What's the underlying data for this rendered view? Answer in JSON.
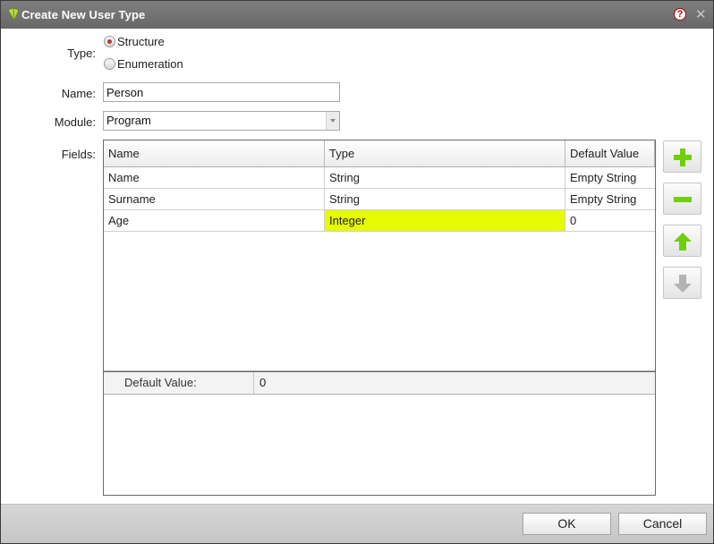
{
  "window": {
    "title": "Create New User Type"
  },
  "form": {
    "type_label": "Type:",
    "type_options": [
      {
        "label": "Structure",
        "checked": true
      },
      {
        "label": "Enumeration",
        "checked": false
      }
    ],
    "name_label": "Name:",
    "name_value": "Person",
    "module_label": "Module:",
    "module_value": "Program",
    "fields_label": "Fields:"
  },
  "fields_table": {
    "columns": [
      "Name",
      "Type",
      "Default Value"
    ],
    "rows": [
      {
        "name": "Name",
        "type": "String",
        "default": "Empty String"
      },
      {
        "name": "Surname",
        "type": "String",
        "default": "Empty String"
      },
      {
        "name": "Age",
        "type": "Integer",
        "default": "0",
        "selected_cell": "type"
      }
    ],
    "selected_color": "#e5fb00"
  },
  "property_panel": {
    "key": "Default Value:",
    "value": "0"
  },
  "side_buttons": [
    {
      "icon": "plus-icon",
      "enabled": true,
      "color": "#6fcf0d"
    },
    {
      "icon": "minus-icon",
      "enabled": true,
      "color": "#6fcf0d"
    },
    {
      "icon": "arrow-up-icon",
      "enabled": true,
      "color": "#6fcf0d"
    },
    {
      "icon": "arrow-down-icon",
      "enabled": false,
      "color": "#b3b3b3"
    }
  ],
  "footer": {
    "ok_label": "OK",
    "cancel_label": "Cancel"
  }
}
